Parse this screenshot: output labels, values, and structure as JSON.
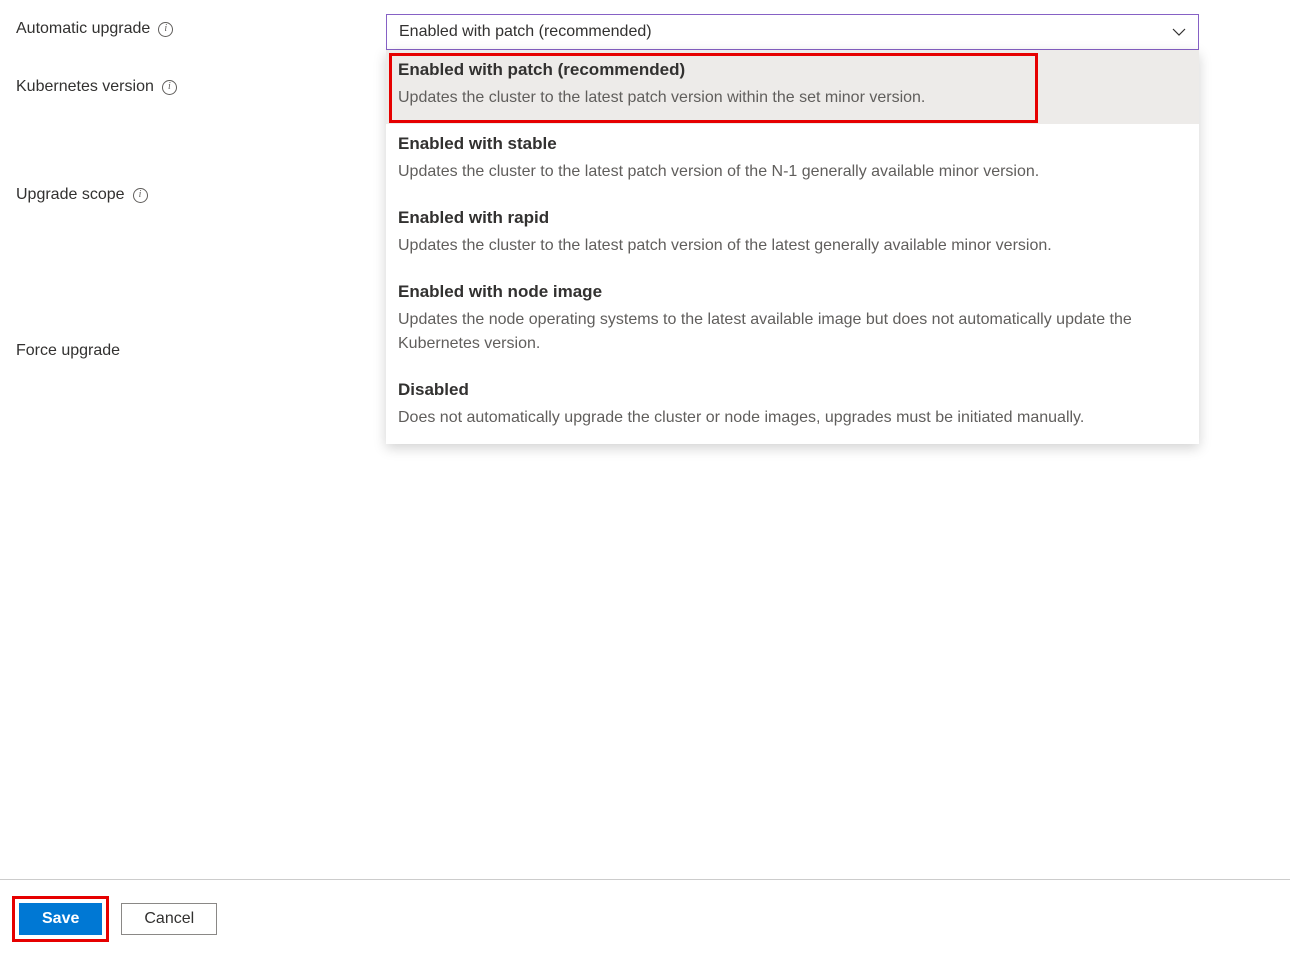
{
  "form": {
    "automatic_upgrade": {
      "label": "Automatic upgrade"
    },
    "kubernetes_version": {
      "label": "Kubernetes version"
    },
    "upgrade_scope": {
      "label": "Upgrade scope"
    },
    "force_upgrade": {
      "label": "Force upgrade"
    }
  },
  "select": {
    "value": "Enabled with patch (recommended)",
    "options": [
      {
        "title": "Enabled with patch (recommended)",
        "desc": "Updates the cluster to the latest patch version within the set minor version.",
        "selected": true
      },
      {
        "title": "Enabled with stable",
        "desc": "Updates the cluster to the latest patch version of the N-1 generally available minor version."
      },
      {
        "title": "Enabled with rapid",
        "desc": "Updates the cluster to the latest patch version of the latest generally available minor version."
      },
      {
        "title": "Enabled with node image",
        "desc": "Updates the node operating systems to the latest available image but does not automatically update the Kubernetes version."
      },
      {
        "title": "Disabled",
        "desc": "Does not automatically upgrade the cluster or node images, upgrades must be initiated manually."
      }
    ]
  },
  "footer": {
    "save": "Save",
    "cancel": "Cancel"
  }
}
